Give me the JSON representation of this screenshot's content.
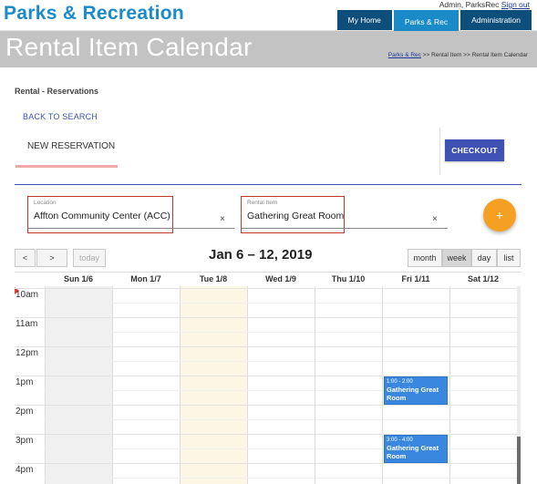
{
  "header": {
    "brand": "Parks & Recreation",
    "user": "Admin, ParksRec",
    "signout": "Sign out",
    "nav": [
      {
        "label": "My Home"
      },
      {
        "label": "Parks & Rec"
      },
      {
        "label": "Administration"
      }
    ],
    "active_nav": "Parks & Rec"
  },
  "titlebar": {
    "title": "Rental Item Calendar",
    "breadcrumb": {
      "link": "Parks & Rec",
      "sep1": " >> Rental Item >> ",
      "current": "Rental Item Calendar"
    }
  },
  "page": {
    "section": "Rental - Reservations",
    "back_link": "BACK TO SEARCH",
    "new_reservation": "NEW RESERVATION",
    "checkout": "CHECKOUT"
  },
  "filters": {
    "location": {
      "label": "Location",
      "value": "Affton Community Center (ACC)",
      "clear": "×"
    },
    "rental_item": {
      "label": "Rental Item",
      "value": "Gathering Great Room",
      "clear": "×"
    },
    "add_button": "+"
  },
  "calendar": {
    "prev": "<",
    "next": ">",
    "today": "today",
    "title": "Jan 6 – 12, 2019",
    "views": [
      "month",
      "week",
      "day",
      "list"
    ],
    "active_view": "week",
    "days": [
      "Sun 1/6",
      "Mon 1/7",
      "Tue 1/8",
      "Wed 1/9",
      "Thu 1/10",
      "Fri 1/11",
      "Sat 1/12"
    ],
    "today_day": "Tue 1/8",
    "hours": [
      "10am",
      "11am",
      "12pm",
      "1pm",
      "2pm",
      "3pm",
      "4pm"
    ],
    "events": [
      {
        "day": "Fri 1/11",
        "time": "1:00 - 2:00",
        "title": "Gathering Great Room"
      },
      {
        "day": "Fri 1/11",
        "time": "3:00 - 4:00",
        "title": "Gathering Great Room"
      }
    ]
  },
  "colors": {
    "brand": "#1a8ac8",
    "nav_dark": "#0e4e7a",
    "primary": "#3f51b5",
    "accent": "#f5a023",
    "event": "#3a87e0",
    "highlight_border": "#c0392b"
  }
}
